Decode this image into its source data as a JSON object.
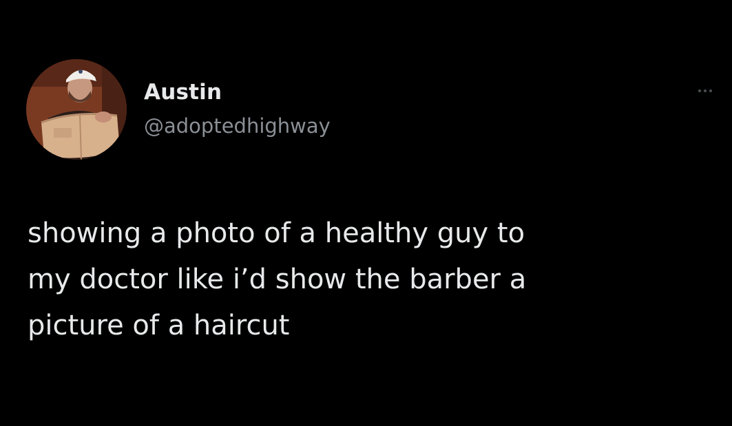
{
  "tweet": {
    "author": {
      "display_name": "Austin",
      "handle": "@adoptedhighway",
      "avatar_icon": "profile-photo-avatar"
    },
    "menu_icon": "more-options-icon",
    "text_lines": [
      "showing a photo of a healthy guy to",
      "my doctor like i’d show the barber a",
      "picture of a haircut"
    ]
  },
  "colors": {
    "background": "#000000",
    "primary_text": "#e7e9ea",
    "secondary_text": "#8b9096",
    "menu_dots": "#4b4f53"
  }
}
